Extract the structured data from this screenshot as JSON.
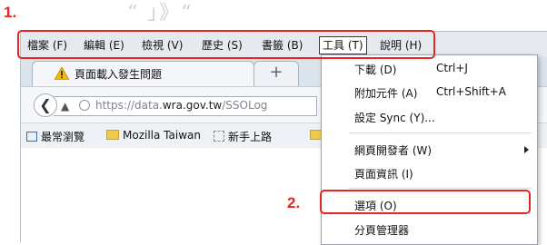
{
  "steps": {
    "one": "1.",
    "two": "2."
  },
  "background_heading": "“  」》“",
  "menubar": {
    "file": "檔案 (F)",
    "edit": "編輯 (E)",
    "view": "檢視 (V)",
    "history": "歷史 (S)",
    "bookmarks": "書籤 (B)",
    "tools": "工具 (T)",
    "help": "說明 (H)"
  },
  "tab": {
    "title": "頁面載入發生問題",
    "new_tab": "+"
  },
  "navbar": {
    "url_prefix": "https://data.",
    "url_domain": "wra.gov.tw",
    "url_suffix": "/SSOLog"
  },
  "bookmarks": {
    "most_visited": "最常瀏覽",
    "mozilla_taiwan": "Mozilla Taiwan",
    "getting_started": "新手上路"
  },
  "tools_menu": {
    "downloads": {
      "label": "下載 (D)",
      "shortcut": "Ctrl+J"
    },
    "addons": {
      "label": "附加元件 (A)",
      "shortcut": "Ctrl+Shift+A"
    },
    "sync": {
      "label": "設定 Sync (Y)..."
    },
    "web_developer": {
      "label": "網頁開發者 (W)"
    },
    "page_info": {
      "label": "頁面資訊 (I)"
    },
    "options": {
      "label": "選項 (O)"
    },
    "tab_groups": {
      "label": "分頁管理器"
    }
  },
  "colors": {
    "highlight": "#e8251e",
    "warning": "#f2b90d"
  }
}
